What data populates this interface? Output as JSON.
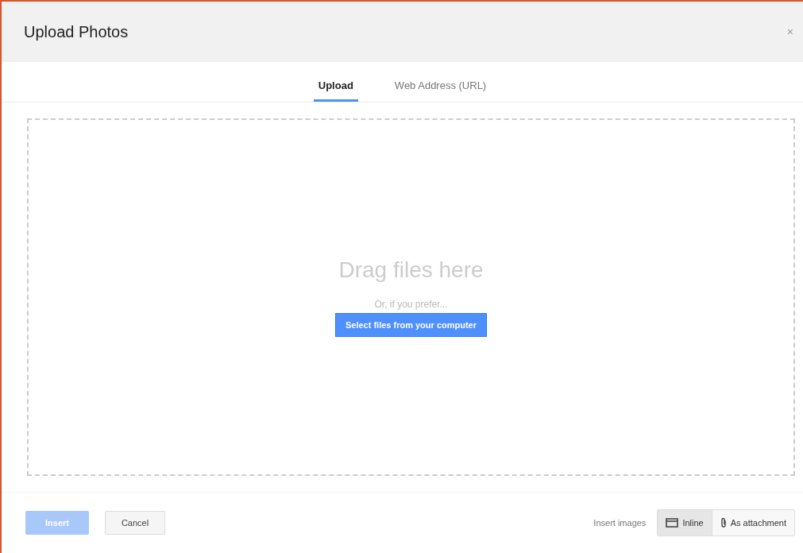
{
  "window": {
    "title": "Upload Photos",
    "close": "×"
  },
  "tabs": [
    {
      "label": "Upload",
      "selected": true
    },
    {
      "label": "Web Address (URL)",
      "selected": false
    }
  ],
  "dropzone": {
    "heading": "Drag files here",
    "hint": "Or, if you prefer...",
    "button": "Select files from your computer"
  },
  "footer": {
    "insert": {
      "label": "Insert",
      "disabled": true
    },
    "cancel": "Cancel",
    "insert_images_label": "Insert images",
    "options": [
      {
        "label": "Inline",
        "kind": "inline",
        "selected": true
      },
      {
        "label": "As attachment",
        "kind": "attachment",
        "selected": false
      }
    ]
  }
}
